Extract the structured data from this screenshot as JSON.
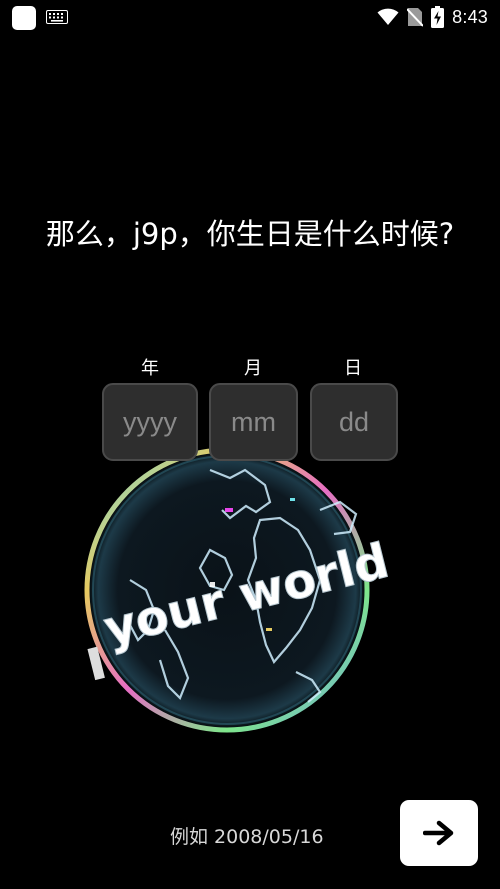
{
  "status_bar": {
    "time": "8:43",
    "icons": [
      "app-icon",
      "keyboard-icon",
      "wifi-icon",
      "no-sim-icon",
      "battery-charging-icon"
    ]
  },
  "question": "那么，j9p，你生日是什么时候?",
  "birthday_form": {
    "year": {
      "label": "年",
      "placeholder": "yyyy",
      "value": ""
    },
    "month": {
      "label": "月",
      "placeholder": "mm",
      "value": ""
    },
    "day": {
      "label": "日",
      "placeholder": "dd",
      "value": ""
    }
  },
  "globe": {
    "banner_text": "your world"
  },
  "hint": "例如 2008/05/16",
  "next_button": {
    "icon": "arrow-right-icon"
  },
  "colors": {
    "background": "#000000",
    "input_bg": "#2e2e2e",
    "input_border": "#4a4a4a",
    "button_bg": "#ffffff"
  }
}
